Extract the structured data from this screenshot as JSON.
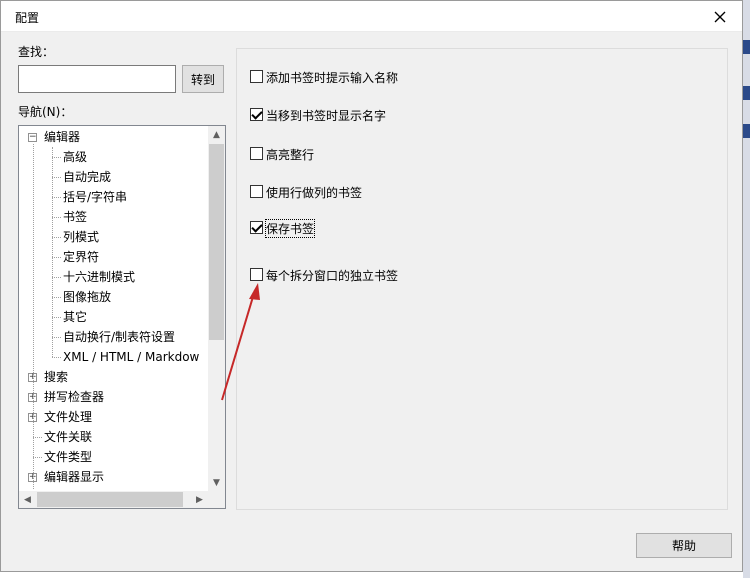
{
  "window": {
    "title": "配置"
  },
  "search": {
    "label": "查找：",
    "value": "",
    "go_label": "转到"
  },
  "navigation": {
    "label": "导航(N)：",
    "tree": [
      {
        "label": "编辑器",
        "level": 0,
        "expander": "minus"
      },
      {
        "label": "高级",
        "level": 1
      },
      {
        "label": "自动完成",
        "level": 1
      },
      {
        "label": "括号/字符串",
        "level": 1
      },
      {
        "label": "书签",
        "level": 1
      },
      {
        "label": "列模式",
        "level": 1
      },
      {
        "label": "定界符",
        "level": 1
      },
      {
        "label": "十六进制模式",
        "level": 1
      },
      {
        "label": "图像拖放",
        "level": 1
      },
      {
        "label": "其它",
        "level": 1
      },
      {
        "label": "自动换行/制表符设置",
        "level": 1
      },
      {
        "label": "XML / HTML / Markdow",
        "level": 1
      },
      {
        "label": "搜索",
        "level": 0,
        "expander": "plus"
      },
      {
        "label": "拼写检查器",
        "level": 0,
        "expander": "plus"
      },
      {
        "label": "文件处理",
        "level": 0,
        "expander": "plus"
      },
      {
        "label": "文件关联",
        "level": 0
      },
      {
        "label": "文件类型",
        "level": 0
      },
      {
        "label": "编辑器显示",
        "level": 0,
        "expander": "plus"
      }
    ]
  },
  "bookmark_options": [
    {
      "label": "添加书签时提示输入名称",
      "checked": false
    },
    {
      "label": "当移到书签时显示名字",
      "checked": true
    },
    {
      "label": "高亮整行",
      "checked": false
    },
    {
      "label": "使用行做列的书签",
      "checked": false
    },
    {
      "label": "保存书签",
      "checked": true,
      "focused": true
    },
    {
      "label": "每个拆分窗口的独立书签",
      "checked": false
    }
  ],
  "footer": {
    "help_label": "帮助"
  },
  "annotation": {
    "color": "#c62828"
  }
}
